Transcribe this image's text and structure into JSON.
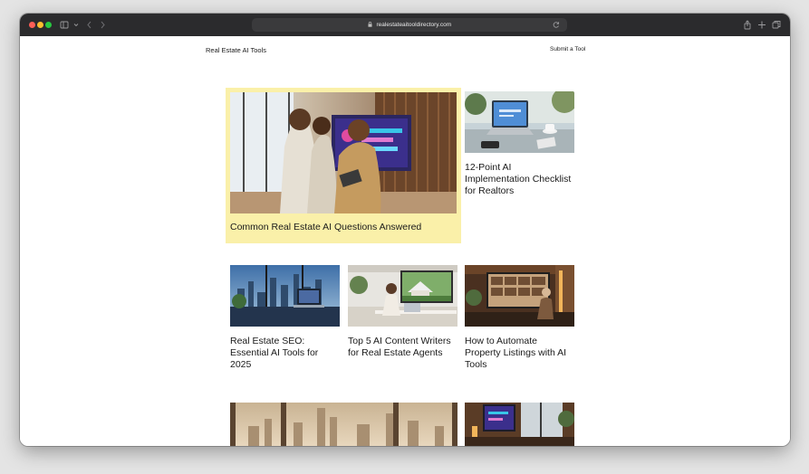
{
  "browser": {
    "url": "realestateaitooldirectory.com"
  },
  "site": {
    "brand": "Real Estate AI Tools",
    "submit_label": "Submit a Tool"
  },
  "articles": [
    {
      "title": "Common Real Estate AI Questions Answered"
    },
    {
      "title": "12-Point AI Implementation Checklist for Realtors"
    },
    {
      "title": "Real Estate SEO: Essential AI Tools for 2025"
    },
    {
      "title": "Top 5 AI Content Writers for Real Estate Agents"
    },
    {
      "title": "How to Automate Property Listings with AI Tools"
    }
  ]
}
